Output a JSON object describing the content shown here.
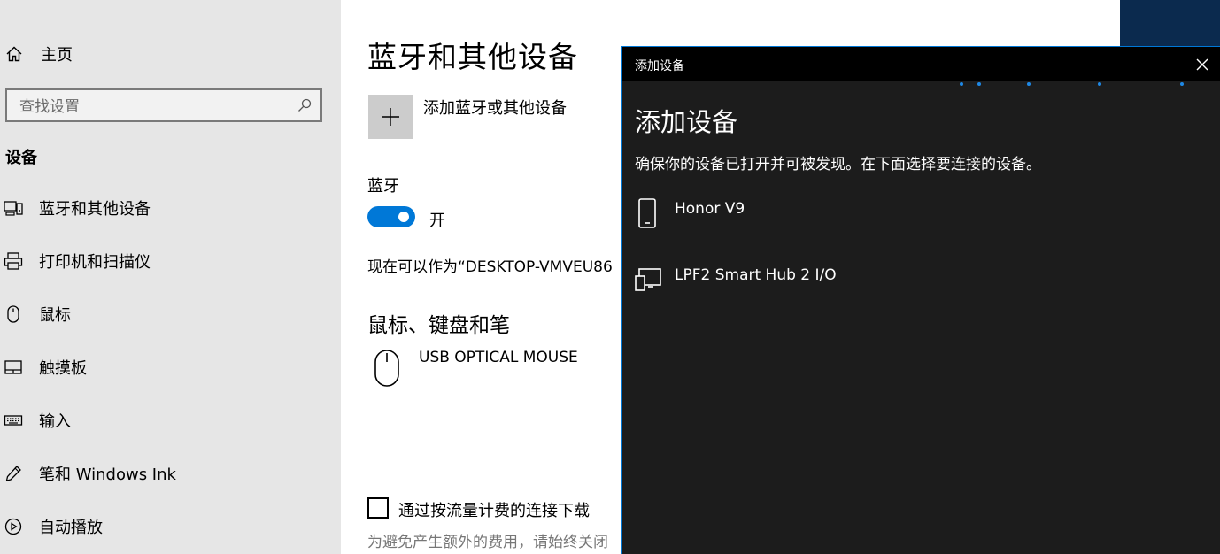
{
  "nav": {
    "home_label": "主页",
    "search_placeholder": "查找设置",
    "section_title": "设备",
    "items": [
      {
        "label": "蓝牙和其他设备",
        "icon": "bluetooth-devices-icon"
      },
      {
        "label": "打印机和扫描仪",
        "icon": "printer-icon"
      },
      {
        "label": "鼠标",
        "icon": "mouse-icon"
      },
      {
        "label": "触摸板",
        "icon": "touchpad-icon"
      },
      {
        "label": "输入",
        "icon": "keyboard-icon"
      },
      {
        "label": "笔和 Windows Ink",
        "icon": "pen-icon"
      },
      {
        "label": "自动播放",
        "icon": "autoplay-icon"
      }
    ]
  },
  "main": {
    "title": "蓝牙和其他设备",
    "add_device_label": "添加蓝牙或其他设备",
    "bluetooth": {
      "heading": "蓝牙",
      "toggle_state": "开",
      "discoverable_text": "现在可以作为“DESKTOP-VMVEU86"
    },
    "mouse_section": {
      "heading": "鼠标、键盘和笔",
      "device_name": "USB OPTICAL MOUSE"
    },
    "metered": {
      "label": "通过按流量计费的连接下载",
      "description": "为避免产生额外的费用，请始终关闭"
    }
  },
  "dialog": {
    "window_title": "添加设备",
    "heading": "添加设备",
    "instruction": "确保你的设备已打开并可被发现。在下面选择要连接的设备。",
    "devices": [
      {
        "name": "Honor V9",
        "icon": "phone-icon"
      },
      {
        "name": "LPF2 Smart Hub 2 I/O",
        "icon": "device-display-icon"
      }
    ]
  },
  "colors": {
    "accent": "#0078d7",
    "nav_background": "#e6e6e6",
    "dialog_background": "#1c1c1c",
    "dialog_titlebar": "#000000"
  }
}
